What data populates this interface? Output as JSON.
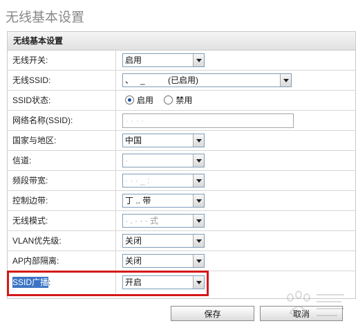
{
  "page": {
    "title": "无线基本设置"
  },
  "panel": {
    "header": "无线基本设置"
  },
  "rows": [
    {
      "label": "无线开关:",
      "type": "select",
      "value": "启用"
    },
    {
      "label": "无线SSID:",
      "type": "select",
      "value": "、   _          (已启用)"
    },
    {
      "label": "SSID状态:",
      "type": "radio",
      "options": [
        "启用",
        "禁用"
      ],
      "selected": "启用"
    },
    {
      "label": "网络名称(SSID):",
      "type": "text",
      "value": "· · · ·"
    },
    {
      "label": "国家与地区:",
      "type": "select",
      "value": "中国"
    },
    {
      "label": "信道:",
      "type": "select",
      "value": "·"
    },
    {
      "label": "频段带宽:",
      "type": "select",
      "value": "· · · _ :"
    },
    {
      "label": "控制边带:",
      "type": "select",
      "value": "丁 .. 带"
    },
    {
      "label": "无线模式:",
      "type": "select",
      "value": "· . · · · 式"
    },
    {
      "label": "VLAN优先级:",
      "type": "select",
      "value": "关闭"
    },
    {
      "label": "AP内部隔离:",
      "type": "select",
      "value": "关闭"
    },
    {
      "label_highlight": "SSID广播",
      "label_suffix": ":",
      "type": "select",
      "value": "开启"
    }
  ],
  "buttons": {
    "save": "保存",
    "cancel": "取消"
  },
  "colors": {
    "highlight_box": "#d41818",
    "selection": "#3b74c4"
  },
  "watermark": {
    "icon": "baidu-jingyan-watermark"
  }
}
